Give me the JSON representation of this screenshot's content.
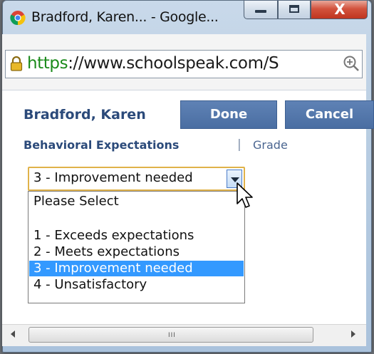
{
  "window": {
    "title": "Bradford, Karen... - Google...",
    "close_glyph": "X",
    "icon": "chrome-icon"
  },
  "address_bar": {
    "url_scheme": "https",
    "url_rest": "://www.schoolspeak.com/S",
    "icons": [
      "lock-icon",
      "zoom-icon"
    ]
  },
  "page": {
    "student_name": "Bradford, Karen",
    "done_label": "Done",
    "cancel_label": "Cancel",
    "tabs": [
      {
        "label": "Behavioral Expectations",
        "active": true
      },
      {
        "label": "Grade",
        "active": false
      }
    ],
    "tab_separator": "|"
  },
  "select": {
    "value": "3 - Improvement needed",
    "options": [
      {
        "label": "Please Select",
        "selected": false
      },
      {
        "label": "",
        "selected": false
      },
      {
        "label": "1 - Exceeds expectations",
        "selected": false
      },
      {
        "label": "2 - Meets expectations",
        "selected": false
      },
      {
        "label": "3 - Improvement needed",
        "selected": true
      },
      {
        "label": "4 - Unsatisfactory",
        "selected": false
      }
    ]
  },
  "scrollbar": {
    "grip": "III"
  },
  "colors": {
    "accent": "#4a6ea2",
    "link": "#2b4a7a",
    "selection": "#3399ff",
    "url_green": "#1a8a1a"
  }
}
